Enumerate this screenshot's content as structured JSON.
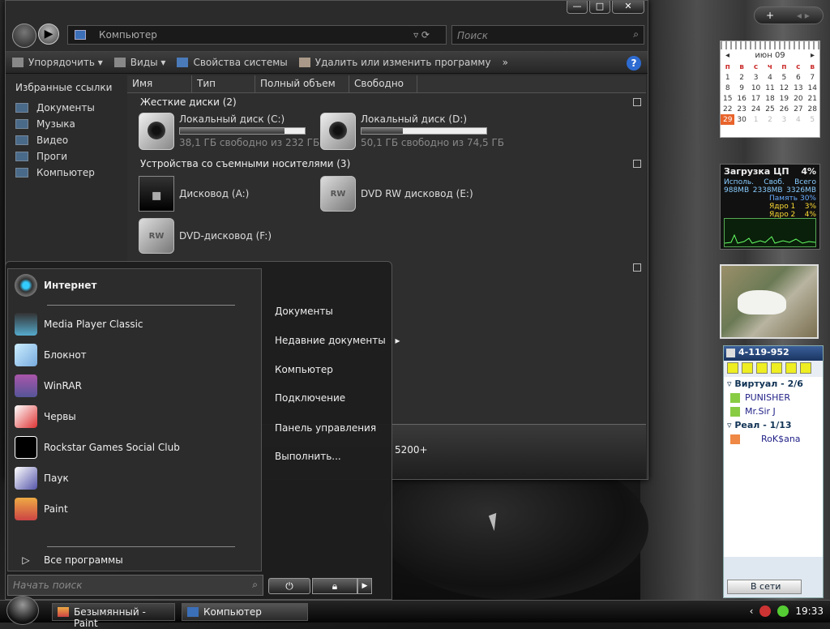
{
  "explorer": {
    "address": "Компьютер",
    "search_placeholder": "Поиск",
    "toolbar": {
      "organize": "Упорядочить",
      "views": "Виды",
      "system_properties": "Свойства системы",
      "uninstall": "Удалить или изменить программу",
      "more": "»"
    },
    "nav": {
      "header": "Избранные ссылки",
      "items": [
        "Документы",
        "Музыка",
        "Видео",
        "Проги",
        "Компьютер"
      ]
    },
    "columns": [
      "Имя",
      "Тип",
      "Полный объем",
      "Свободно"
    ],
    "groups": {
      "hdd": "Жесткие диски (2)",
      "removable": "Устройства со съемными носителями (3)"
    },
    "drives": [
      {
        "name": "Локальный диск (C:)",
        "free": "38,1 ГБ свободно из 232 ГБ",
        "used_fraction": 0.84
      },
      {
        "name": "Локальный диск (D:)",
        "free": "50,1 ГБ свободно из 74,5 ГБ",
        "used_fraction": 0.33
      }
    ],
    "removable": [
      "Дисковод (A:)",
      "DVD RW дисковод (E:)",
      "DVD-дисковод (F:)"
    ],
    "details_text": "5200+"
  },
  "start_menu": {
    "pinned": "Интернет",
    "programs": [
      "Media Player Classic",
      "Блокнот",
      "WinRAR",
      "Червы",
      "Rockstar Games Social Club",
      "Паук",
      "Paint"
    ],
    "all_programs": "Все программы",
    "search_placeholder": "Начать поиск",
    "right": [
      "Документы",
      "Недавние документы",
      "Компьютер",
      "Подключение",
      "Панель управления",
      "Выполнить..."
    ]
  },
  "taskbar": {
    "buttons": [
      "Безымянный - Paint",
      "Компьютер"
    ],
    "clock": "19:33"
  },
  "calendar": {
    "month": "июн 09",
    "weekdays": [
      "п",
      "в",
      "с",
      "ч",
      "п",
      "с",
      "в"
    ],
    "weeks": [
      [
        "1",
        "2",
        "3",
        "4",
        "5",
        "6",
        "7"
      ],
      [
        "8",
        "9",
        "10",
        "11",
        "12",
        "13",
        "14"
      ],
      [
        "15",
        "16",
        "17",
        "18",
        "19",
        "20",
        "21"
      ],
      [
        "22",
        "23",
        "24",
        "25",
        "26",
        "27",
        "28"
      ],
      [
        "29",
        "30",
        "1",
        "2",
        "3",
        "4",
        "5"
      ]
    ]
  },
  "cpu_gadget": {
    "title": "Загрузка ЦП",
    "total": "4%",
    "labels": [
      "Исполь.",
      "Своб.",
      "Всего"
    ],
    "values": [
      "988MB",
      "2338MB",
      "3326MB"
    ],
    "memory_label": "Память",
    "memory": "30%",
    "core1_label": "Ядро 1",
    "core1": "3%",
    "core2_label": "Ядро 2",
    "core2": "4%"
  },
  "icq": {
    "uin": "4-119-952",
    "groups": [
      {
        "name": "Виртуал - 2/6",
        "contacts": [
          "PUNISHER",
          "Mr.Sir J"
        ]
      },
      {
        "name": "Реал - 1/13",
        "contacts": [
          "RoK$ana"
        ]
      }
    ],
    "status": "В сети"
  },
  "colors": {
    "accent": "#e8632b",
    "help": "#2d6bd1"
  }
}
